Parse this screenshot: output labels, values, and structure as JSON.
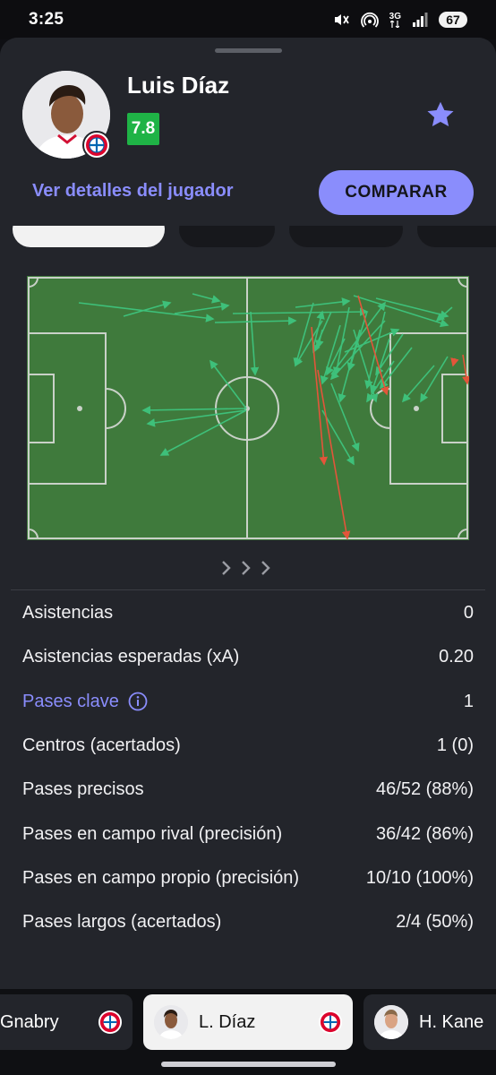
{
  "status_bar": {
    "time": "3:25",
    "network": "3G",
    "battery": "67"
  },
  "player": {
    "name": "Luis Díaz",
    "rating": "7.8",
    "rating_color": "#1fb346",
    "details_link": "Ver detalles del jugador",
    "compare_button": "COMPARAR",
    "favorite_icon": "star-icon"
  },
  "accent_color": "#8a8dfc",
  "stats": [
    {
      "label": "Asistencias",
      "value": "0"
    },
    {
      "label": "Asistencias esperadas (xA)",
      "value": "0.20"
    },
    {
      "label": "Pases clave",
      "value": "1",
      "link": true,
      "icon": "info-icon"
    },
    {
      "label": "Centros (acertados)",
      "value": "1 (0)"
    },
    {
      "label": "Pases precisos",
      "value": "46/52 (88%)"
    },
    {
      "label": "Pases en campo rival (precisión)",
      "value": "36/42 (86%)"
    },
    {
      "label": "Pases en campo propio (precisión)",
      "value": "10/10 (100%)"
    },
    {
      "label": "Pases largos (acertados)",
      "value": "2/4 (50%)"
    }
  ],
  "player_switcher": [
    {
      "name": "Gnabry",
      "badge": "bayern-badge-icon"
    },
    {
      "name": "L. Díaz",
      "badge": "bayern-badge-icon",
      "active": true
    },
    {
      "name": "H. Kane",
      "badge": ""
    }
  ],
  "pitch": {
    "direction_icon": "chevron-right-icon",
    "successful_color": "#3ec07a",
    "failed_color": "#e3553a"
  }
}
